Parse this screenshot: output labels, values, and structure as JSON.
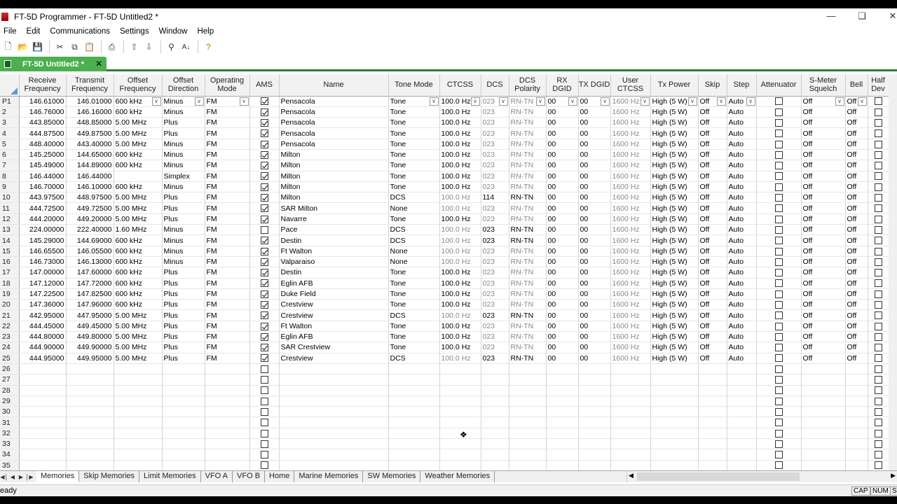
{
  "window": {
    "title": "FT-5D Programmer - FT-5D Untitled2 *"
  },
  "menu": [
    "File",
    "Edit",
    "Communications",
    "Settings",
    "Window",
    "Help"
  ],
  "toolbar_icons": [
    "new-icon",
    "open-icon",
    "save-icon",
    "cut-icon",
    "copy-icon",
    "paste-icon",
    "print-icon",
    "move-up-icon",
    "move-down-icon",
    "find-icon",
    "sort-icon",
    "help-icon"
  ],
  "doc_tab": {
    "label": "FT-5D Untitled2 *"
  },
  "columns": [
    "Receive Frequency",
    "Transmit Frequency",
    "Offset Frequency",
    "Offset Direction",
    "Operating Mode",
    "AMS",
    "Name",
    "Tone Mode",
    "CTCSS",
    "DCS",
    "DCS Polarity",
    "RX DGID",
    "TX DGID",
    "User CTCSS",
    "Tx Power",
    "Skip",
    "Step",
    "Attenuator",
    "S-Meter Squelch",
    "Bell",
    "Half Dev"
  ],
  "rows": [
    [
      "P1",
      "146.61000",
      "146.01000",
      "600 kHz",
      "Minus",
      "FM",
      true,
      "Pensacola",
      "Tone",
      "100.0 Hz",
      "023",
      "RN-TN",
      "00",
      "00",
      "1600 Hz",
      "High (5 W)",
      "Off",
      "Auto",
      false,
      "Off",
      "Off",
      false
    ],
    [
      "2",
      "146.76000",
      "146.16000",
      "600 kHz",
      "Minus",
      "FM",
      true,
      "Pensacola",
      "Tone",
      "100.0 Hz",
      "023",
      "RN-TN",
      "00",
      "00",
      "1600 Hz",
      "High (5 W)",
      "Off",
      "Auto",
      false,
      "Off",
      "Off",
      false
    ],
    [
      "3",
      "443.85000",
      "448.85000",
      "5.00 MHz",
      "Plus",
      "FM",
      true,
      "Pensacola",
      "Tone",
      "100.0 Hz",
      "023",
      "RN-TN",
      "00",
      "00",
      "1600 Hz",
      "High (5 W)",
      "Off",
      "Auto",
      false,
      "Off",
      "Off",
      false
    ],
    [
      "4",
      "444.87500",
      "449.87500",
      "5.00 MHz",
      "Plus",
      "FM",
      true,
      "Pensacola",
      "Tone",
      "100.0 Hz",
      "023",
      "RN-TN",
      "00",
      "00",
      "1600 Hz",
      "High (5 W)",
      "Off",
      "Auto",
      false,
      "Off",
      "Off",
      false
    ],
    [
      "5",
      "448.40000",
      "443.40000",
      "5.00 MHz",
      "Minus",
      "FM",
      true,
      "Pensacola",
      "Tone",
      "100.0 Hz",
      "023",
      "RN-TN",
      "00",
      "00",
      "1600 Hz",
      "High (5 W)",
      "Off",
      "Auto",
      false,
      "Off",
      "Off",
      false
    ],
    [
      "6",
      "145.25000",
      "144.65000",
      "600 kHz",
      "Minus",
      "FM",
      true,
      "Milton",
      "Tone",
      "100.0 Hz",
      "023",
      "RN-TN",
      "00",
      "00",
      "1600 Hz",
      "High (5 W)",
      "Off",
      "Auto",
      false,
      "Off",
      "Off",
      false
    ],
    [
      "7",
      "145.49000",
      "144.89000",
      "600 kHz",
      "Minus",
      "FM",
      true,
      "Milton",
      "Tone",
      "100.0 Hz",
      "023",
      "RN-TN",
      "00",
      "00",
      "1600 Hz",
      "High (5 W)",
      "Off",
      "Auto",
      false,
      "Off",
      "Off",
      false
    ],
    [
      "8",
      "146.44000",
      "146.44000",
      "",
      "Simplex",
      "FM",
      true,
      "Milton",
      "Tone",
      "100.0 Hz",
      "023",
      "RN-TN",
      "00",
      "00",
      "1600 Hz",
      "High (5 W)",
      "Off",
      "Auto",
      false,
      "Off",
      "Off",
      false
    ],
    [
      "9",
      "146.70000",
      "146.10000",
      "600 kHz",
      "Minus",
      "FM",
      true,
      "Milton",
      "Tone",
      "100.0 Hz",
      "023",
      "RN-TN",
      "00",
      "00",
      "1600 Hz",
      "High (5 W)",
      "Off",
      "Auto",
      false,
      "Off",
      "Off",
      false
    ],
    [
      "10",
      "443.97500",
      "448.97500",
      "5.00 MHz",
      "Plus",
      "FM",
      true,
      "Milton",
      "DCS",
      "100.0 Hz",
      "114",
      "RN-TN",
      "00",
      "00",
      "1600 Hz",
      "High (5 W)",
      "Off",
      "Auto",
      false,
      "Off",
      "Off",
      false
    ],
    [
      "11",
      "444.72500",
      "449.72500",
      "5.00 MHz",
      "Plus",
      "FM",
      true,
      "SAR Milton",
      "None",
      "100.0 Hz",
      "023",
      "RN-TN",
      "00",
      "00",
      "1600 Hz",
      "High (5 W)",
      "Off",
      "Auto",
      false,
      "Off",
      "Off",
      false
    ],
    [
      "12",
      "444.20000",
      "449.20000",
      "5.00 MHz",
      "Plus",
      "FM",
      true,
      "Navarre",
      "Tone",
      "100.0 Hz",
      "023",
      "RN-TN",
      "00",
      "00",
      "1600 Hz",
      "High (5 W)",
      "Off",
      "Auto",
      false,
      "Off",
      "Off",
      false
    ],
    [
      "13",
      "224.00000",
      "222.40000",
      "1.60 MHz",
      "Minus",
      "FM",
      false,
      "Pace",
      "DCS",
      "100.0 Hz",
      "023",
      "RN-TN",
      "00",
      "00",
      "1600 Hz",
      "High (5 W)",
      "Off",
      "Auto",
      false,
      "Off",
      "Off",
      false
    ],
    [
      "14",
      "145.29000",
      "144.69000",
      "600 kHz",
      "Minus",
      "FM",
      true,
      "Destin",
      "DCS",
      "100.0 Hz",
      "023",
      "RN-TN",
      "00",
      "00",
      "1600 Hz",
      "High (5 W)",
      "Off",
      "Auto",
      false,
      "Off",
      "Off",
      false
    ],
    [
      "15",
      "146.65500",
      "146.05500",
      "600 kHz",
      "Minus",
      "FM",
      true,
      "Ft Walton",
      "None",
      "100.0 Hz",
      "023",
      "RN-TN",
      "00",
      "00",
      "1600 Hz",
      "High (5 W)",
      "Off",
      "Auto",
      false,
      "Off",
      "Off",
      false
    ],
    [
      "16",
      "146.73000",
      "146.13000",
      "600 kHz",
      "Minus",
      "FM",
      true,
      "Valparaiso",
      "None",
      "100.0 Hz",
      "023",
      "RN-TN",
      "00",
      "00",
      "1600 Hz",
      "High (5 W)",
      "Off",
      "Auto",
      false,
      "Off",
      "Off",
      false
    ],
    [
      "17",
      "147.00000",
      "147.60000",
      "600 kHz",
      "Plus",
      "FM",
      true,
      "Destin",
      "Tone",
      "100.0 Hz",
      "023",
      "RN-TN",
      "00",
      "00",
      "1600 Hz",
      "High (5 W)",
      "Off",
      "Auto",
      false,
      "Off",
      "Off",
      false
    ],
    [
      "18",
      "147.12000",
      "147.72000",
      "600 kHz",
      "Plus",
      "FM",
      true,
      "Eglin AFB",
      "Tone",
      "100.0 Hz",
      "023",
      "RN-TN",
      "00",
      "00",
      "1600 Hz",
      "High (5 W)",
      "Off",
      "Auto",
      false,
      "Off",
      "Off",
      false
    ],
    [
      "19",
      "147.22500",
      "147.82500",
      "600 kHz",
      "Plus",
      "FM",
      true,
      "Duke Field",
      "Tone",
      "100.0 Hz",
      "023",
      "RN-TN",
      "00",
      "00",
      "1600 Hz",
      "High (5 W)",
      "Off",
      "Auto",
      false,
      "Off",
      "Off",
      false
    ],
    [
      "20",
      "147.36000",
      "147.96000",
      "600 kHz",
      "Plus",
      "FM",
      true,
      "Crestview",
      "Tone",
      "100.0 Hz",
      "023",
      "RN-TN",
      "00",
      "00",
      "1600 Hz",
      "High (5 W)",
      "Off",
      "Auto",
      false,
      "Off",
      "Off",
      false
    ],
    [
      "21",
      "442.95000",
      "447.95000",
      "5.00 MHz",
      "Plus",
      "FM",
      true,
      "Crestview",
      "DCS",
      "100.0 Hz",
      "023",
      "RN-TN",
      "00",
      "00",
      "1600 Hz",
      "High (5 W)",
      "Off",
      "Auto",
      false,
      "Off",
      "Off",
      false
    ],
    [
      "22",
      "444.45000",
      "449.45000",
      "5.00 MHz",
      "Plus",
      "FM",
      true,
      "Ft Walton",
      "Tone",
      "100.0 Hz",
      "023",
      "RN-TN",
      "00",
      "00",
      "1600 Hz",
      "High (5 W)",
      "Off",
      "Auto",
      false,
      "Off",
      "Off",
      false
    ],
    [
      "23",
      "444.80000",
      "449.80000",
      "5.00 MHz",
      "Plus",
      "FM",
      true,
      "Eglin AFB",
      "Tone",
      "100.0 Hz",
      "023",
      "RN-TN",
      "00",
      "00",
      "1600 Hz",
      "High (5 W)",
      "Off",
      "Auto",
      false,
      "Off",
      "Off",
      false
    ],
    [
      "24",
      "444.90000",
      "449.90000",
      "5.00 MHz",
      "Plus",
      "FM",
      true,
      "SAR Crestview",
      "Tone",
      "100.0 Hz",
      "023",
      "RN-TN",
      "00",
      "00",
      "1600 Hz",
      "High (5 W)",
      "Off",
      "Auto",
      false,
      "Off",
      "Off",
      false
    ],
    [
      "25",
      "444.95000",
      "449.95000",
      "5.00 MHz",
      "Plus",
      "FM",
      true,
      "Crestview",
      "DCS",
      "100.0 Hz",
      "023",
      "RN-TN",
      "00",
      "00",
      "1600 Hz",
      "High (5 W)",
      "Off",
      "Auto",
      false,
      "Off",
      "Off",
      false
    ]
  ],
  "empty_row_numbers": [
    "26",
    "27",
    "28",
    "29",
    "30",
    "31",
    "32",
    "33",
    "34",
    "35"
  ],
  "sheet_tabs": [
    "Memories",
    "Skip Memories",
    "Limit Memories",
    "VFO A",
    "VFO B",
    "Home",
    "Marine Memories",
    "SW Memories",
    "Weather Memories"
  ],
  "active_sheet": "Memories",
  "status": {
    "text": "eady",
    "cap": "CAP",
    "num": "NUM",
    "scrl": "S"
  },
  "colors": {
    "doc_tab": "#4caf50",
    "accent": "#2e7d32"
  }
}
